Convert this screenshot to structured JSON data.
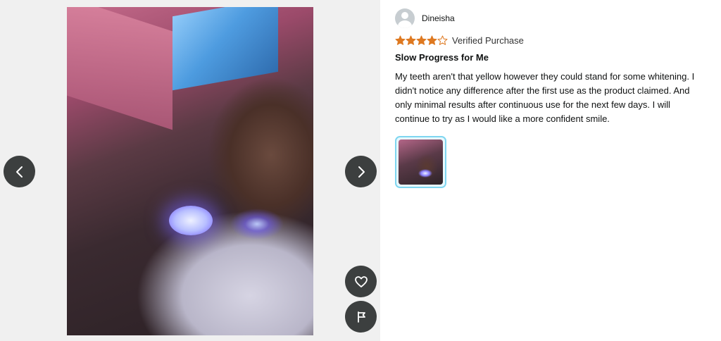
{
  "viewer": {
    "photo_alt": "Customer review photo",
    "prev_icon": "chevron-left-icon",
    "next_icon": "chevron-right-icon",
    "like_icon": "heart-icon",
    "report_icon": "flag-icon"
  },
  "review": {
    "author": "Dineisha",
    "rating": 4,
    "rating_max": 5,
    "verified": "Verified Purchase",
    "title": "Slow Progress for Me",
    "body": "My teeth aren't that yellow however they could stand for some whitening. I didn't notice any difference after the first use as the product claimed. And only minimal results after continuous use for the next few days. I will continue to try as I would like a more confident smile."
  },
  "colors": {
    "star": "#de7921",
    "nav_button": "#3c3f3f",
    "thumb_border": "#7fd6f0"
  }
}
